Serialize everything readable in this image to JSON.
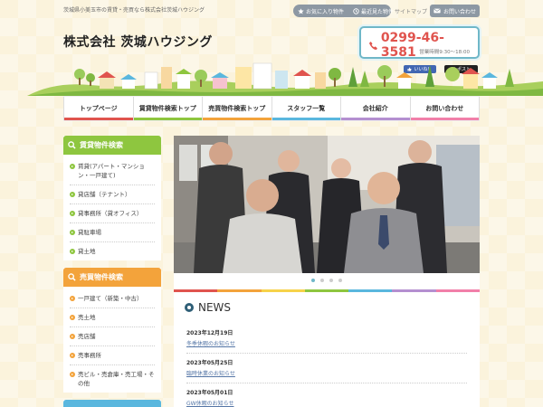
{
  "header": {
    "tagline": "茨城県小美玉市の賃貸・売買なら株式会社茨城ハウジング",
    "favorites_label": "お気に入り物件",
    "recent_label": "最近見た物件",
    "sitemap_label": "サイトマップ",
    "contact_label": "お問い合わせ",
    "logo_text": "株式会社 茨城ハウジング",
    "phone_number": "0299-46-3581",
    "phone_hours": "営業時間9:30～18:00",
    "like_label": "いいね！",
    "post_label": "ポスト"
  },
  "nav": {
    "items": [
      {
        "label": "トップページ",
        "color": "#e0544e"
      },
      {
        "label": "賃貸物件検索トップ",
        "color": "#8ec63f"
      },
      {
        "label": "売買物件検索トップ",
        "color": "#f3a33b"
      },
      {
        "label": "スタッフ一覧",
        "color": "#5ab7de"
      },
      {
        "label": "会社紹介",
        "color": "#b48fd0"
      },
      {
        "label": "お問い合わせ",
        "color": "#f17fa9"
      }
    ]
  },
  "sidebar": {
    "rent": {
      "title": "賃貸物件検索",
      "items": [
        "賃貸(アパート・マンション・一戸建て)",
        "貸店舗（テナント）",
        "貸事務所（貸オフィス）",
        "貸駐車場",
        "貸土地"
      ]
    },
    "sale": {
      "title": "売買物件検索",
      "items": [
        "一戸建て（新築・中古）",
        "売土地",
        "売店舗",
        "売事務所",
        "売ビル・売倉庫・売工場・その他"
      ]
    }
  },
  "slider": {
    "count": 4,
    "active_index": 0
  },
  "news": {
    "title": "NEWS",
    "items": [
      {
        "date": "2023年12月19日",
        "title": "冬季休暇のお知らせ"
      },
      {
        "date": "2023年05月25日",
        "title": "臨時休業のお知らせ"
      },
      {
        "date": "2023年05月01日",
        "title": "GW休暇のお知らせ"
      }
    ]
  },
  "colors": {
    "accent_teal": "#6fb7c8",
    "phone_red": "#e0544e",
    "rent_green": "#8ec63f",
    "sale_orange": "#f3a33b",
    "link_blue": "#5576a6"
  }
}
